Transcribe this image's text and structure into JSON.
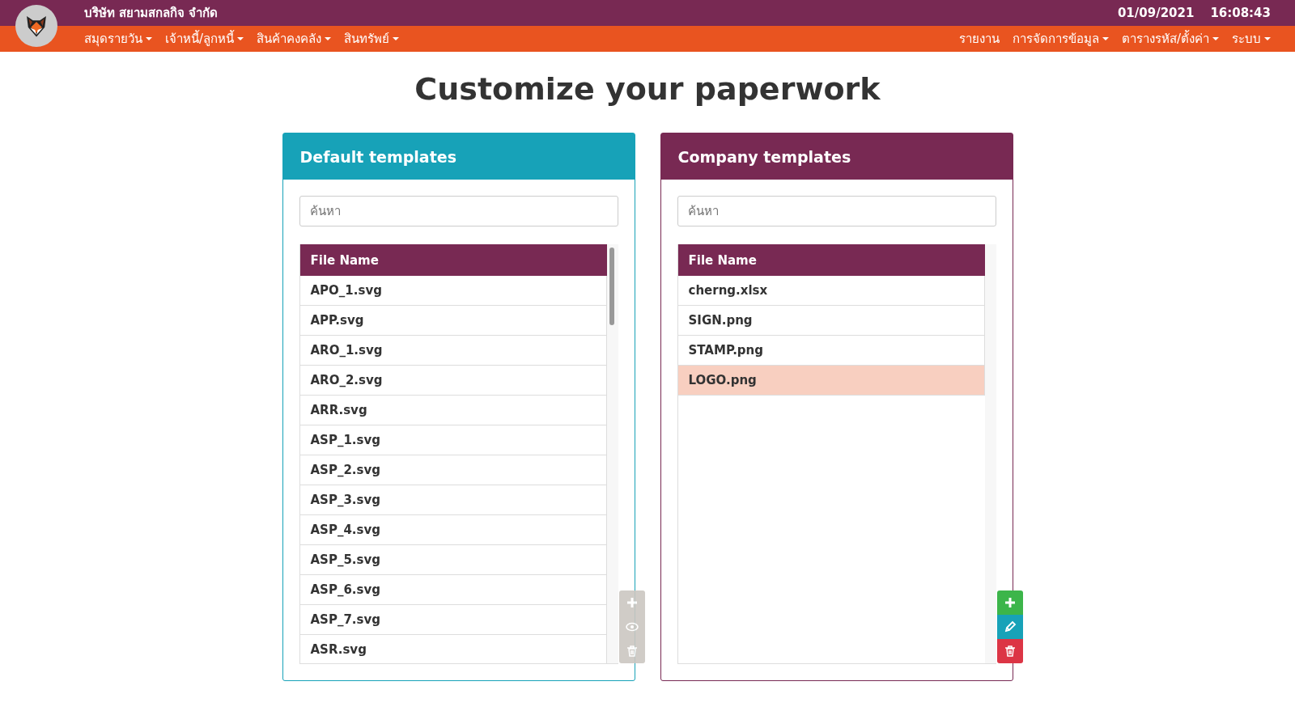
{
  "header": {
    "company": "บริษัท สยามสกลกิจ จำกัด",
    "date": "01/09/2021",
    "time": "16:08:43"
  },
  "menu_left": [
    {
      "label": "สมุดรายวัน",
      "dropdown": true
    },
    {
      "label": "เจ้าหนี้/ลูกหนี้",
      "dropdown": true
    },
    {
      "label": "สินค้าคงคลัง",
      "dropdown": true
    },
    {
      "label": "สินทรัพย์",
      "dropdown": true
    }
  ],
  "menu_right": [
    {
      "label": "รายงาน",
      "dropdown": false
    },
    {
      "label": "การจัดการข้อมูล",
      "dropdown": true
    },
    {
      "label": "ตารางรหัส/ตั้งค่า",
      "dropdown": true
    },
    {
      "label": "ระบบ",
      "dropdown": true
    }
  ],
  "title": "Customize your paperwork",
  "panels": [
    {
      "title": "Default templates",
      "color": "#17a2b8",
      "search": {
        "placeholder": "ค้นหา"
      },
      "column": "File Name",
      "scrollbar": true,
      "rows": [
        {
          "name": "APO_1.svg",
          "selected": false
        },
        {
          "name": "APP.svg",
          "selected": false
        },
        {
          "name": "ARO_1.svg",
          "selected": false
        },
        {
          "name": "ARO_2.svg",
          "selected": false
        },
        {
          "name": "ARR.svg",
          "selected": false
        },
        {
          "name": "ASP_1.svg",
          "selected": false
        },
        {
          "name": "ASP_2.svg",
          "selected": false
        },
        {
          "name": "ASP_3.svg",
          "selected": false
        },
        {
          "name": "ASP_4.svg",
          "selected": false
        },
        {
          "name": "ASP_5.svg",
          "selected": false
        },
        {
          "name": "ASP_6.svg",
          "selected": false
        },
        {
          "name": "ASP_7.svg",
          "selected": false
        },
        {
          "name": "ASR.svg",
          "selected": false
        }
      ],
      "buttons": [
        {
          "kind": "add",
          "disabled": true
        },
        {
          "kind": "view",
          "disabled": true
        },
        {
          "kind": "delete",
          "disabled": true
        }
      ]
    },
    {
      "title": "Company templates",
      "color": "#782953",
      "search": {
        "placeholder": "ค้นหา"
      },
      "column": "File Name",
      "scrollbar": false,
      "rows": [
        {
          "name": "cherng.xlsx",
          "selected": false
        },
        {
          "name": "SIGN.png",
          "selected": false
        },
        {
          "name": "STAMP.png",
          "selected": false
        },
        {
          "name": "LOGO.png",
          "selected": true
        }
      ],
      "buttons": [
        {
          "kind": "add",
          "disabled": false
        },
        {
          "kind": "edit",
          "disabled": false
        },
        {
          "kind": "delete",
          "disabled": false
        }
      ]
    }
  ]
}
